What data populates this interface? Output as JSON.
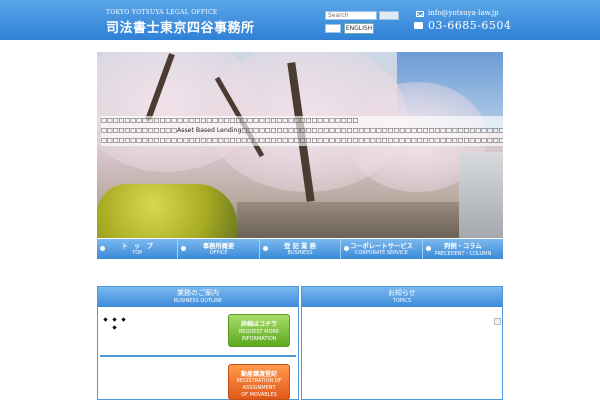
{
  "header": {
    "brand_en": "TOKYO YOTSUYA LEGAL OFFICE",
    "brand_jp": "司法書士東京四谷事務所",
    "search_placeholder": "Search",
    "language_label": "ENGLISH",
    "email": "info@yotsuya-law.jp",
    "phone": "03-6685-6504"
  },
  "hero": {
    "lines": [
      "□□□□□□□□□□□□□□□□□□□□□□□□□□□□□□□□□□□□□□□□□□□□",
      "□□□□□□□□□□□□□Asset Based Lending□□□□□□□□□□□□□□□□□□□□□□□□□□□□□□□□□□□□□□□□□□□□□□□□",
      "□□□□□□□□□□□□□□□□□□□□□□□□□□□□□□□□□□□□□□□□□□□□□□□□□□□□□□□□□□□□□□□□□□□□□□□□□□□□□□□□□□"
    ]
  },
  "nav": [
    {
      "label_jp": "ト　ッ　プ",
      "label_en": "TOP"
    },
    {
      "label_jp": "事務所概要",
      "label_en": "OFFICE"
    },
    {
      "label_jp": "登 記 業 務",
      "label_en": "BUSINESS"
    },
    {
      "label_jp": "コーポレートサービス",
      "label_en": "CORPORATE SERVICE"
    },
    {
      "label_jp": "判例・コラム",
      "label_en": "PRECEDENT・COLUMN"
    }
  ],
  "business_panel": {
    "title": "業務のご案内",
    "subtitle": "BUSINESS OUTLINE",
    "request_button": {
      "jp": "詳細はコチラ",
      "en_line1": "REQUEST MORE",
      "en_line2": "INFORMATION"
    },
    "registration_button": {
      "jp": "動産譲渡登記",
      "en_line1": "REGISTRATION OF",
      "en_line2": "ASSIGNMENT",
      "en_line3": "OF MOVABLES"
    }
  },
  "topics_panel": {
    "title": "お知らせ",
    "subtitle": "TOPICS"
  },
  "colors": {
    "header_blue": "#2f80d6",
    "nav_blue": "#3a8ad8",
    "panel_border": "#4d97dd",
    "green_button": "#5ea81e",
    "orange_button": "#e0581a"
  }
}
